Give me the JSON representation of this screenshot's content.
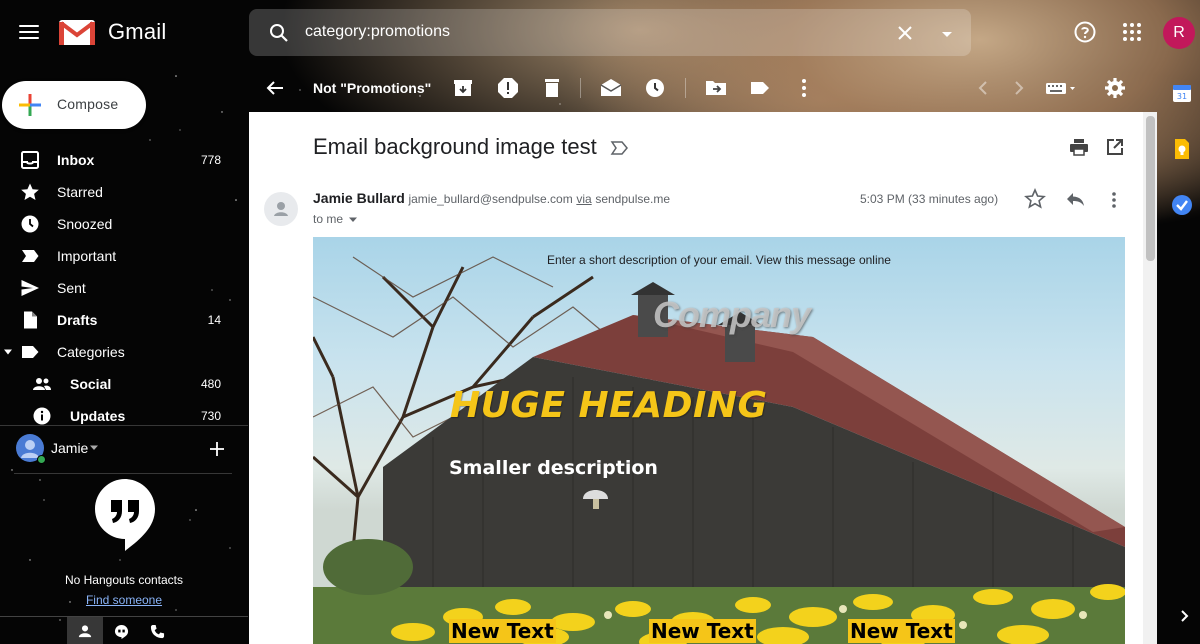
{
  "app": {
    "title": "Gmail",
    "user_initial": "R"
  },
  "search": {
    "value": "category:promotions"
  },
  "compose": {
    "label": "Compose"
  },
  "nav": {
    "items": [
      {
        "label": "Inbox",
        "count": "778"
      },
      {
        "label": "Starred",
        "count": ""
      },
      {
        "label": "Snoozed",
        "count": ""
      },
      {
        "label": "Important",
        "count": ""
      },
      {
        "label": "Sent",
        "count": ""
      },
      {
        "label": "Drafts",
        "count": "14"
      },
      {
        "label": "Categories",
        "count": ""
      },
      {
        "label": "Social",
        "count": "480"
      },
      {
        "label": "Updates",
        "count": "730"
      }
    ]
  },
  "hangouts": {
    "user_name": "Jamie",
    "no_contacts": "No Hangouts contacts",
    "find_link": "Find someone"
  },
  "toolbar": {
    "not_label": "Not \"Promotions\""
  },
  "email": {
    "subject": "Email background image test",
    "sender_name": "Jamie Bullard",
    "sender_email": "jamie_bullard@sendpulse.com",
    "via_label": "via",
    "via_domain": "sendpulse.me",
    "to": "to me",
    "time": "5:03 PM (33 minutes ago)",
    "body": {
      "preheader": "Enter a short description of your email. View this message online",
      "company": "Company",
      "heading": "HUGE HEADING",
      "description": "Smaller description",
      "columns": [
        "New Text",
        "New Text",
        "New Text"
      ]
    }
  },
  "colors": {
    "accent_yellow": "#f5c518",
    "avatar_r": "#c2185b",
    "link_blue": "#8ab4f8"
  },
  "icons": {
    "side_panel": [
      "calendar-icon",
      "keep-icon",
      "tasks-icon"
    ]
  }
}
